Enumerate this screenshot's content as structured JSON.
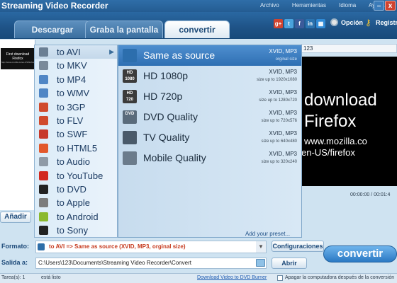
{
  "app": {
    "title": "Streaming Video Recorder",
    "menu": [
      "Archivo",
      "Herramientas",
      "Idioma",
      "Ayuda"
    ],
    "min_glyph": "–",
    "close_glyph": "x"
  },
  "tabs": [
    "Descargar",
    "Graba la pantalla",
    "convertir"
  ],
  "header": {
    "option_label": "Opción",
    "register_label": "Registr",
    "social_icons": [
      "google-plus-icon",
      "twitter-icon",
      "facebook-icon",
      "linkedin-icon",
      "windows-icon"
    ]
  },
  "thumbnail": {
    "line1": "First download",
    "line2": "Firefox",
    "line3": "http://www.mozilla.co/es-US/firefox"
  },
  "preview": {
    "topbar": "123",
    "line1": "download",
    "line2": "Firefox",
    "line3": "www.mozilla.co",
    "line4": "en-US/firefox",
    "time": "00:00:00 / 00:01:4"
  },
  "categories": [
    {
      "label": "to AVI",
      "icon": "avi-file-icon",
      "color": "#6b7f94"
    },
    {
      "label": "to MKV",
      "icon": "mkv-file-icon",
      "color": "#7a8a9a"
    },
    {
      "label": "to MP4",
      "icon": "mp4-file-icon",
      "color": "#4f86c5"
    },
    {
      "label": "to WMV",
      "icon": "wmv-file-icon",
      "color": "#4f86c5"
    },
    {
      "label": "to 3GP",
      "icon": "3gp-file-icon",
      "color": "#d04a2c"
    },
    {
      "label": "to FLV",
      "icon": "flv-file-icon",
      "color": "#d04a2c"
    },
    {
      "label": "to SWF",
      "icon": "swf-file-icon",
      "color": "#c7392b"
    },
    {
      "label": "to HTML5",
      "icon": "html5-icon",
      "color": "#e2582b"
    },
    {
      "label": "to Audio",
      "icon": "music-note-icon",
      "color": "#8f9aa6"
    },
    {
      "label": "to YouTube",
      "icon": "youtube-icon",
      "color": "#d2281f"
    },
    {
      "label": "to DVD",
      "icon": "dvd-icon",
      "color": "#222222"
    },
    {
      "label": "to Apple",
      "icon": "apple-icon",
      "color": "#7c7c7c"
    },
    {
      "label": "to Android",
      "icon": "android-icon",
      "color": "#8bb92d"
    },
    {
      "label": "to Sony",
      "icon": "playstation-icon",
      "color": "#222222"
    }
  ],
  "options": [
    {
      "label": "Same as source",
      "codec": "XVID, MP3",
      "size": "orginal size",
      "icon": "film-strip-icon",
      "icon_text": "",
      "selected": true
    },
    {
      "label": "HD 1080p",
      "codec": "XVID, MP3",
      "size": "size up to 1920x1080",
      "icon": "hd-1080p-icon",
      "icon_text": "HD 1080",
      "selected": false
    },
    {
      "label": "HD 720p",
      "codec": "XVID, MP3",
      "size": "size up to 1280x720",
      "icon": "hd-720p-icon",
      "icon_text": "HD 720",
      "selected": false
    },
    {
      "label": "DVD Quality",
      "codec": "XVID, MP3",
      "size": "size up to 720x576",
      "icon": "dvd-quality-icon",
      "icon_text": "DVD",
      "selected": false
    },
    {
      "label": "TV Quality",
      "codec": "XVID, MP3",
      "size": "size up to 640x480",
      "icon": "tv-icon",
      "icon_text": "",
      "selected": false
    },
    {
      "label": "Mobile Quality",
      "codec": "XVID, MP3",
      "size": "size up to 320x240",
      "icon": "mobile-phone-icon",
      "icon_text": "",
      "selected": false
    }
  ],
  "add_preset": "Add your preset...",
  "bottom": {
    "add_label": "Añadir",
    "format_label": "Formato:",
    "format_value": "to AVI => Same as source (XVID, MP3, orginal size)",
    "config_label": "Configuraciones",
    "output_label": "Salida a:",
    "output_value": "C:\\Users\\123\\Documents\\Streaming Video Recorder\\Convert",
    "open_label": "Abrir",
    "convert_label": "convertir"
  },
  "status": {
    "tasks": "Tarea(s): 1",
    "state": "está listo",
    "link": "Download Video to DVD Burner",
    "shutdown": "Apagar la computadora después de la conversión"
  }
}
